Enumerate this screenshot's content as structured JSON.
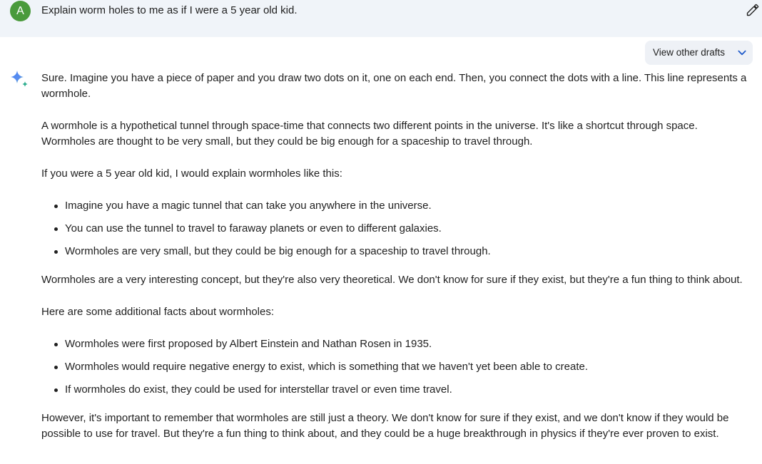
{
  "prompt": {
    "avatar_letter": "A",
    "text": "Explain worm holes to me as if I were a 5 year old kid.",
    "edit_icon": "pencil-icon"
  },
  "response": {
    "drafts_label": "View other drafts",
    "drafts_icon": "chevron-down-icon",
    "model_icon": "sparkle-icon",
    "intro": "Sure. Imagine you have a piece of paper and you draw two dots on it, one on each end. Then, you connect the dots with a line. This line represents a wormhole.",
    "definition": "A wormhole is a hypothetical tunnel through space-time that connects two different points in the universe. It's like a shortcut through space. Wormholes are thought to be very small, but they could be big enough for a spaceship to travel through.",
    "kid_intro": "If you were a 5 year old kid, I would explain wormholes like this:",
    "kid_points": [
      "Imagine you have a magic tunnel that can take you anywhere in the universe.",
      "You can use the tunnel to travel to faraway planets or even to different galaxies.",
      "Wormholes are very small, but they could be big enough for a spaceship to travel through."
    ],
    "concept": "Wormholes are a very interesting concept, but they're also very theoretical. We don't know for sure if they exist, but they're a fun thing to think about.",
    "facts_intro": "Here are some additional facts about wormholes:",
    "facts": [
      "Wormholes were first proposed by Albert Einstein and Nathan Rosen in 1935.",
      "Wormholes would require negative energy to exist, which is something that we haven't yet been able to create.",
      "If wormholes do exist, they could be used for interstellar travel or even time travel."
    ],
    "conclusion": "However, it's important to remember that wormholes are still just a theory. We don't know for sure if they exist, and we don't know if they would be possible to use for travel. But they're a fun thing to think about, and they could be a huge breakthrough in physics if they're ever proven to exist."
  },
  "colors": {
    "prompt_background": "#f0f4f9",
    "avatar": "#4a9a3c",
    "text": "#1f1f1f",
    "sparkle_blue": "#4285f4"
  }
}
